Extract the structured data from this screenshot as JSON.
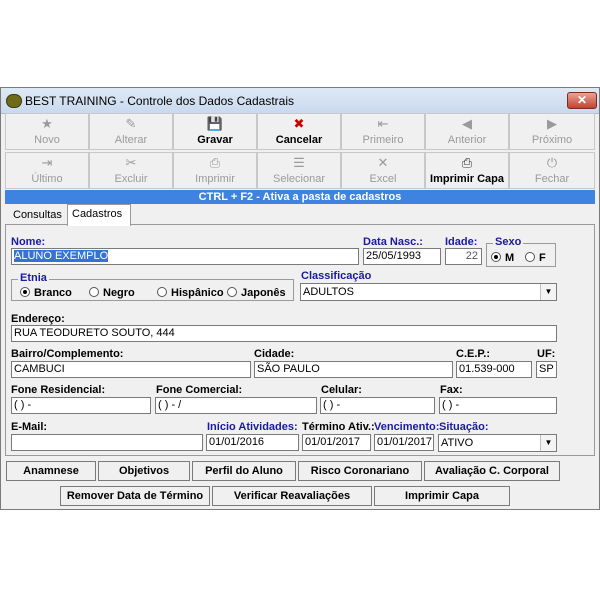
{
  "window": {
    "title": "BEST TRAINING - Controle dos Dados Cadastrais",
    "close": "✕"
  },
  "toolbar": {
    "row1": [
      {
        "label": "Novo",
        "icon": "★",
        "enabled": false
      },
      {
        "label": "Alterar",
        "icon": "✎",
        "enabled": false
      },
      {
        "label": "Gravar",
        "icon": "💾",
        "enabled": true
      },
      {
        "label": "Cancelar",
        "icon": "✖",
        "enabled": true
      },
      {
        "label": "Primeiro",
        "icon": "⇤",
        "enabled": false
      },
      {
        "label": "Anterior",
        "icon": "◀",
        "enabled": false
      },
      {
        "label": "Próximo",
        "icon": "▶",
        "enabled": false
      }
    ],
    "row2": [
      {
        "label": "Último",
        "icon": "⇥",
        "enabled": false
      },
      {
        "label": "Excluir",
        "icon": "✂",
        "enabled": false
      },
      {
        "label": "Imprimir",
        "icon": "⎙",
        "enabled": false
      },
      {
        "label": "Selecionar",
        "icon": "☰",
        "enabled": false
      },
      {
        "label": "Excel",
        "icon": "✕",
        "enabled": false
      },
      {
        "label": "Imprimir Capa",
        "icon": "⎙",
        "enabled": true
      },
      {
        "label": "Fechar",
        "icon": "⏻",
        "enabled": false
      }
    ]
  },
  "hint": "CTRL + F2 - Ativa a pasta de cadastros",
  "tabs": {
    "consultas": "Consultas",
    "cadastros": "Cadastros"
  },
  "form": {
    "nome": {
      "label": "Nome:",
      "value": "ALUNO EXEMPLO"
    },
    "data_nasc": {
      "label": "Data Nasc.:",
      "value": "25/05/1993"
    },
    "idade": {
      "label": "Idade:",
      "value": "22"
    },
    "sexo": {
      "label": "Sexo",
      "options": [
        "M",
        "F"
      ],
      "selected": "M"
    },
    "etnia": {
      "label": "Etnia",
      "options": [
        "Branco",
        "Negro",
        "Hispânico",
        "Japonês"
      ],
      "selected": "Branco"
    },
    "classificacao": {
      "label": "Classificação",
      "value": "ADULTOS"
    },
    "endereco": {
      "label": "Endereço:",
      "value": "RUA TEODURETO SOUTO, 444"
    },
    "bairro": {
      "label": "Bairro/Complemento:",
      "value": "CAMBUCI"
    },
    "cidade": {
      "label": "Cidade:",
      "value": "SÃO PAULO"
    },
    "cep": {
      "label": "C.E.P.:",
      "value": "01.539-000"
    },
    "uf": {
      "label": "UF:",
      "value": "SP"
    },
    "fone_res": {
      "label": "Fone Residencial:",
      "value": "( )   -"
    },
    "fone_com": {
      "label": "Fone Comercial:",
      "value": "( )   -   /"
    },
    "celular": {
      "label": "Celular:",
      "value": "( )   -"
    },
    "fax": {
      "label": "Fax:",
      "value": "( )   -"
    },
    "email": {
      "label": "E-Mail:",
      "value": ""
    },
    "inicio": {
      "label": "Início Atividades:",
      "value": "01/01/2016"
    },
    "termino": {
      "label": "Término Ativ.:",
      "value": "01/01/2017"
    },
    "vencimento": {
      "label": "Vencimento:",
      "value": "01/01/2017"
    },
    "situacao": {
      "label": "Situação:",
      "value": "ATIVO"
    }
  },
  "bottom_row1": [
    "Anamnese",
    "Objetivos",
    "Perfil do Aluno",
    "Risco Coronariano",
    "Avaliação C. Corporal"
  ],
  "bottom_row2": [
    "Remover Data de Término",
    "Verificar Reavaliações",
    "Imprimir Capa"
  ]
}
